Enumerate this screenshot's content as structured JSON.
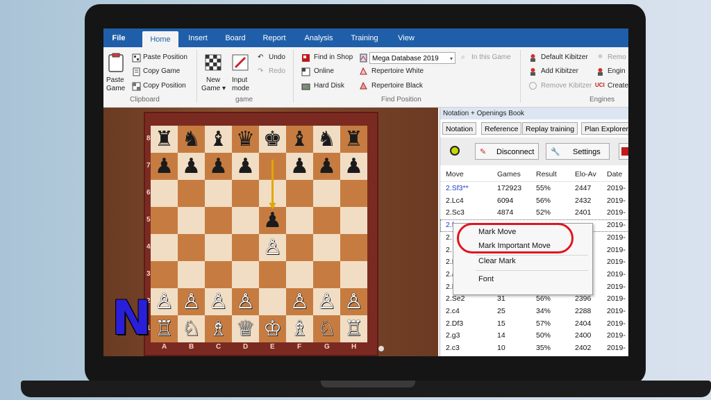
{
  "ribbon_tabs": [
    "File",
    "Home",
    "Insert",
    "Board",
    "Report",
    "Analysis",
    "Training",
    "View"
  ],
  "active_tab": "Home",
  "clipboard": {
    "paste_game": "Paste Game",
    "paste_game_line1": "Paste",
    "paste_game_line2": "Game",
    "paste_position": "Paste Position",
    "copy_game": "Copy Game",
    "copy_position": "Copy Position",
    "group_label": "Clipboard"
  },
  "game": {
    "new_game_line1": "New",
    "new_game_line2": "Game ▾",
    "input_mode_line1": "Input",
    "input_mode_line2": "mode",
    "undo": "Undo",
    "redo": "Redo",
    "group_label": "game"
  },
  "find": {
    "find_in_shop": "Find in Shop",
    "online": "Online",
    "hard_disk": "Hard Disk",
    "database_select": "Mega Database 2019",
    "in_this_game": "In this Game",
    "repertoire_white": "Repertoire White",
    "repertoire_black": "Repertoire Black",
    "group_label": "Find Position"
  },
  "engines": {
    "default_kibitzer": "Default Kibitzer",
    "add_kibitzer": "Add Kibitzer",
    "remove_kibitzer": "Remove Kibitzer",
    "remove": "Remo",
    "engine": "Engin",
    "create": "Create",
    "group_label": "Engines"
  },
  "board": {
    "files": [
      "A",
      "B",
      "C",
      "D",
      "E",
      "F",
      "G",
      "H"
    ],
    "ranks": [
      "8",
      "7",
      "6",
      "5",
      "4",
      "3",
      "2",
      "1"
    ],
    "position": [
      [
        "♜",
        "♞",
        "♝",
        "♛",
        "♚",
        "♝",
        "♞",
        "♜"
      ],
      [
        "♟",
        "♟",
        "♟",
        "♟",
        "",
        "♟",
        "♟",
        "♟"
      ],
      [
        "",
        "",
        "",
        "",
        "",
        "",
        "",
        ""
      ],
      [
        "",
        "",
        "",
        "",
        "♟",
        "",
        "",
        ""
      ],
      [
        "",
        "",
        "",
        "",
        "♙",
        "",
        "",
        ""
      ],
      [
        "",
        "",
        "",
        "",
        "",
        "",
        "",
        ""
      ],
      [
        "♙",
        "♙",
        "♙",
        "♙",
        "",
        "♙",
        "♙",
        "♙"
      ],
      [
        "♖",
        "♘",
        "♗",
        "♕",
        "♔",
        "♗",
        "♘",
        "♖"
      ]
    ],
    "logo_letter": "N"
  },
  "pane": {
    "title": "Notation + Openings Book",
    "tabs": [
      "Notation",
      "Reference",
      "Replay training",
      "Plan Explorer"
    ],
    "disconnect": "Disconnect",
    "settings": "Settings",
    "columns": [
      "Move",
      "Games",
      "Result",
      "Elo-Av",
      "Date"
    ],
    "rows": [
      [
        "2.Sf3**",
        "172923",
        "55%",
        "2447",
        "2019-"
      ],
      [
        "2.Lc4",
        "6094",
        "56%",
        "2432",
        "2019-"
      ],
      [
        "2.Sc3",
        "4874",
        "52%",
        "2401",
        "2019-"
      ],
      [
        "2.f",
        "",
        "",
        "",
        "2019-"
      ],
      [
        "2.",
        "",
        "",
        "",
        "2019-"
      ],
      [
        "2.",
        "",
        "",
        "",
        "2019-"
      ],
      [
        "2.L",
        "",
        "",
        "",
        "2019-"
      ],
      [
        "2.a",
        "",
        "",
        "",
        "2019-"
      ],
      [
        "2.Dh",
        "",
        "45%",
        "2425",
        "2019-"
      ],
      [
        "2.Se2",
        "31",
        "56%",
        "2396",
        "2019-"
      ],
      [
        "2.c4",
        "25",
        "34%",
        "2288",
        "2019-"
      ],
      [
        "2.Df3",
        "15",
        "57%",
        "2404",
        "2019-"
      ],
      [
        "2.g3",
        "14",
        "50%",
        "2400",
        "2019-"
      ],
      [
        "2.c3",
        "10",
        "35%",
        "2402",
        "2019-"
      ]
    ]
  },
  "context_menu": {
    "mark_move": "Mark Move",
    "mark_important_move": "Mark Important Move",
    "clear_mark": "Clear Mark",
    "font": "Font"
  }
}
